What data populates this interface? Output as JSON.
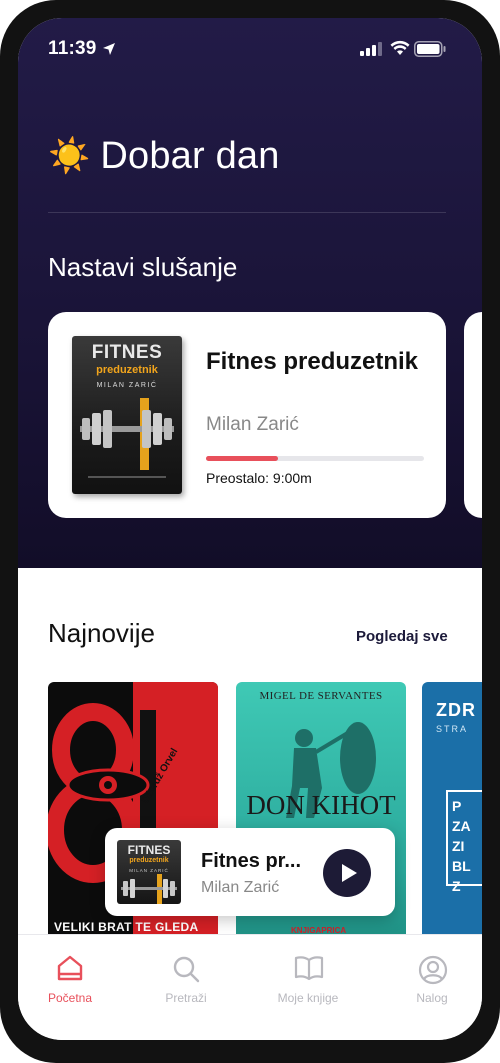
{
  "status_bar": {
    "time": "11:39"
  },
  "greeting": {
    "emoji": "☀️",
    "text": "Dobar dan"
  },
  "continue_listening": {
    "section_title": "Nastavi slušanje",
    "book": {
      "title": "Fitnes preduzetnik",
      "author": "Milan Zarić",
      "progress": 0.33,
      "remaining_label": "Preostalo: 9:00m",
      "cover": {
        "title": "FITNES",
        "subtitle": "preduzetnik",
        "author": "MILAN ZARIĆ"
      }
    }
  },
  "latest": {
    "section_title": "Najnovije",
    "see_all_label": "Pogledaj sve",
    "books": [
      {
        "cover_numbers": "84",
        "cover_author": "Džordž Orvel",
        "cover_footer": "VELIKI BRAT TE GLEDA"
      },
      {
        "cover_author": "MIGEL DE SERVANTES",
        "cover_title": "DON KIHOT",
        "cover_publisher": "KNJIGAPRICA"
      },
      {
        "cover_title": "ZDR",
        "cover_subtitle": "STRA",
        "cover_lines": [
          "P",
          "ZA",
          "ZI",
          "BL",
          "Z"
        ]
      }
    ]
  },
  "mini_player": {
    "title": "Fitnes pr...",
    "author": "Milan Zarić",
    "cover": {
      "title": "FITNES",
      "subtitle": "preduzetnik",
      "author": "MILAN ZARIĆ"
    }
  },
  "tab_bar": [
    {
      "label": "Početna",
      "icon": "home-icon",
      "active": true
    },
    {
      "label": "Pretraži",
      "icon": "search-icon",
      "active": false
    },
    {
      "label": "Moje knjige",
      "icon": "book-icon",
      "active": false
    },
    {
      "label": "Nalog",
      "icon": "account-icon",
      "active": false
    }
  ],
  "colors": {
    "hero": "#1c1640",
    "accent": "#e8505b",
    "dark": "#1d1b36"
  }
}
